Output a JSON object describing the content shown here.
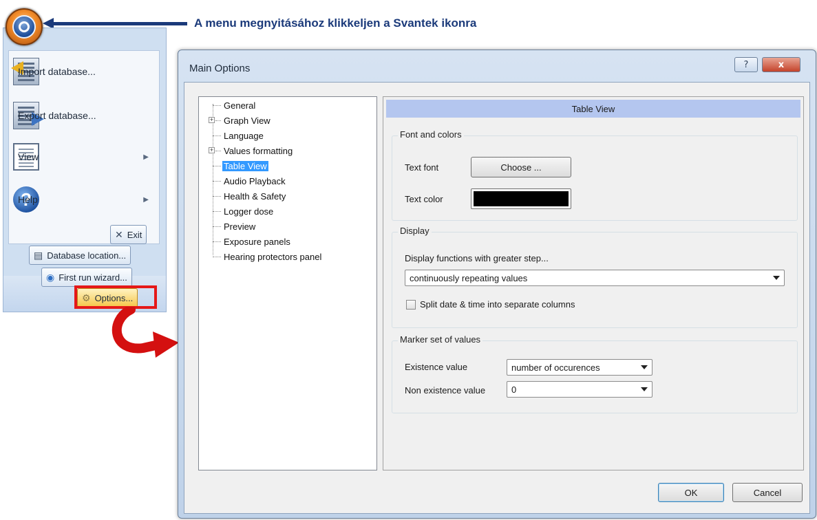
{
  "annotation": "A menu megnyitásához klikkeljen a  Svantek  ikonra",
  "app_menu": {
    "items": [
      {
        "label": "Import database...",
        "icon": "import-database-icon"
      },
      {
        "label": "Export database...",
        "icon": "export-database-icon"
      },
      {
        "label": "View",
        "icon": "view-icon"
      },
      {
        "label": "Help",
        "icon": "help-icon"
      }
    ],
    "exit": "Exit",
    "database_location": "Database location...",
    "first_run_wizard": "First run wizard...",
    "options": "Options..."
  },
  "dialog": {
    "title": "Main Options",
    "help_glyph": "?",
    "close_glyph": "x",
    "tree": [
      {
        "label": "General",
        "expandable": false,
        "selected": false
      },
      {
        "label": "Graph View",
        "expandable": true,
        "selected": false
      },
      {
        "label": "Language",
        "expandable": false,
        "selected": false
      },
      {
        "label": "Values formatting",
        "expandable": true,
        "selected": false
      },
      {
        "label": "Table View",
        "expandable": false,
        "selected": true
      },
      {
        "label": "Audio Playback",
        "expandable": false,
        "selected": false
      },
      {
        "label": "Health & Safety",
        "expandable": false,
        "selected": false
      },
      {
        "label": "Logger dose",
        "expandable": false,
        "selected": false
      },
      {
        "label": "Preview",
        "expandable": false,
        "selected": false
      },
      {
        "label": "Exposure panels",
        "expandable": false,
        "selected": false
      },
      {
        "label": "Hearing protectors panel",
        "expandable": false,
        "selected": false
      }
    ],
    "panel_title": "Table View",
    "font_colors": {
      "group": "Font and colors",
      "text_font_label": "Text font",
      "choose_button": "Choose ...",
      "text_color_label": "Text color",
      "text_color": "#000000"
    },
    "display": {
      "group": "Display",
      "step_label": "Display functions with greater step...",
      "step_value": "continuously repeating values",
      "split_label": "Split date & time into separate columns",
      "split_checked": false
    },
    "marker": {
      "group": "Marker set of values",
      "existence_label": "Existence value",
      "existence_value": "number of occurences",
      "non_existence_label": "Non existence value",
      "non_existence_value": "0"
    },
    "ok": "OK",
    "cancel": "Cancel"
  }
}
